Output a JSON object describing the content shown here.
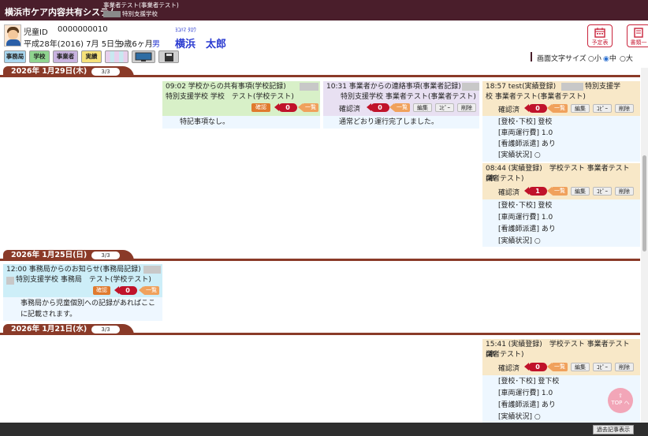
{
  "header": {
    "app_title": "横浜市ケア内容共有システム",
    "sub_line1": "事業者テスト(事業者テスト)",
    "sub_line2": "特別支援学校"
  },
  "patient": {
    "id_label": "児童ID",
    "id_value": "0000000010",
    "birth": "平成28年(2016) 7月 5日生",
    "age": "9歳6ヶ月",
    "gender": "男",
    "name_kana": "ﾖｺﾊﾏ ﾀﾛｳ",
    "name": "横浜　太郎"
  },
  "top_buttons": [
    {
      "label": "予定表",
      "icon": "calendar-icon"
    },
    {
      "label": "書類一",
      "icon": "document-icon"
    }
  ],
  "filters": [
    {
      "label": "事務局",
      "color": "#a8d7f0"
    },
    {
      "label": "学校",
      "color": "#8fd48f"
    },
    {
      "label": "事業者",
      "color": "#c8b3e0"
    },
    {
      "label": "実績",
      "color": "#f6e27a"
    },
    {
      "label": "",
      "color": "#e8d0ec",
      "icon": "stripes-icon"
    },
    {
      "label": "",
      "color": "#d0d0d0",
      "icon": "monitor-icon"
    },
    {
      "label": "",
      "color": "#d0d0d0",
      "icon": "floppy-icon"
    }
  ],
  "font_size": {
    "label": "画面文字サイズ",
    "options": [
      "小",
      "中",
      "大"
    ],
    "selected": "中"
  },
  "days": [
    {
      "date": "2026年 1月29日(木)",
      "count": "3/3"
    },
    {
      "date": "2026年 1月25日(日)",
      "count": "3/3"
    },
    {
      "date": "2026年 1月21日(水)",
      "count": "3/3"
    }
  ],
  "cards": {
    "c1": {
      "title": "09:02 学校からの共有事項(学校記録)",
      "sub": "特別支援学校 学校　テスト(学校テスト)",
      "confirm": "確認",
      "count": "0",
      "list": "一覧",
      "body": "特記事項なし。",
      "bg": "#d8f0c8"
    },
    "c2": {
      "title": "10:31 事業者からの連絡事項(事業者記録)",
      "sub": "特別支援学校 事業者テスト(事業者テスト)",
      "confirm": "確認済",
      "count": "0",
      "list": "一覧",
      "edit": "編集",
      "copy": "ｺﾋﾟｰ",
      "del": "削除",
      "body": "通常どおり運行完了しました。",
      "bg": "#e8e0f2"
    },
    "c3": {
      "title": "18:57 test(実績登録)",
      "title2": "特別支援学",
      "sub": "校 事業者テスト(事業者テスト)",
      "confirm": "確認済",
      "count": "0",
      "list": "一覧",
      "edit": "編集",
      "copy": "ｺﾋﾟｰ",
      "del": "削除",
      "lines": [
        "[登校･下校] 登校",
        "[車両運行費] 1.0",
        "[看護師派遣] あり",
        "[実績状況] ○"
      ],
      "bg": "#f8e8c8"
    },
    "c4": {
      "title": "08:44 (実績登録)　学校テスト 事業者テスト(事",
      "sub": "業者テスト)",
      "confirm": "確認済",
      "count": "1",
      "list": "一覧",
      "edit": "編集",
      "copy": "ｺﾋﾟｰ",
      "del": "削除",
      "lines": [
        "[登校･下校] 登校",
        "[車両運行費] 1.0",
        "[看護師派遣] あり",
        "[実績状況] ○"
      ],
      "bg": "#f8e8c8"
    },
    "c5": {
      "title": "12:00 事務局からのお知らせ(事務局記録)",
      "sub": "特別支援学校 事務局　テスト(学校テスト)",
      "confirm": "確認",
      "count": "0",
      "list": "一覧",
      "body1": "事務局から児童個別への記録があればここ",
      "body2": "に記載されます。",
      "bg": "#cdeef8"
    },
    "c6": {
      "title": "15:41 (実績登録)　学校テスト 事業者テスト(事",
      "sub": "業者テスト)",
      "confirm": "確認済",
      "count": "0",
      "list": "一覧",
      "edit": "編集",
      "copy": "ｺﾋﾟｰ",
      "del": "削除",
      "lines": [
        "[登校･下校] 登下校",
        "[車両運行費] 1.0",
        "[看護師派遣] あり",
        "[実績状況] ○"
      ],
      "bg": "#f8e8c8"
    }
  },
  "top_button": {
    "label": "TOP へ"
  },
  "bottom": {
    "past_label": "過去記事表示"
  }
}
